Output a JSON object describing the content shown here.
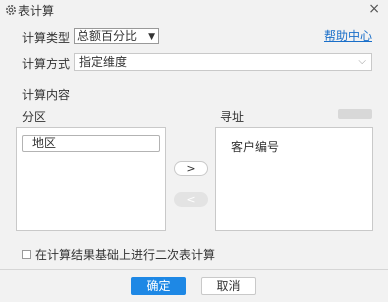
{
  "window": {
    "title": "表计算",
    "icon": "gear-icon",
    "close_glyph": "×"
  },
  "form": {
    "calc_type_label": "计算类型",
    "calc_type_value": "总额百分比",
    "help_link": "帮助中心",
    "calc_method_label": "计算方式",
    "calc_method_value": "指定维度"
  },
  "content": {
    "section_label": "计算内容",
    "partition_label": "分区",
    "partition_items": [
      "地区"
    ],
    "address_label": "寻址",
    "address_items": [
      "客户编号"
    ],
    "move_right_glyph": ">",
    "move_left_glyph": "<"
  },
  "options": {
    "secondary_calc_label": "在计算结果基础上进行二次表计算",
    "secondary_calc_checked": false
  },
  "buttons": {
    "ok": "确定",
    "cancel": "取消"
  },
  "colors": {
    "primary": "#1e88e5",
    "link": "#1a6fc9"
  }
}
